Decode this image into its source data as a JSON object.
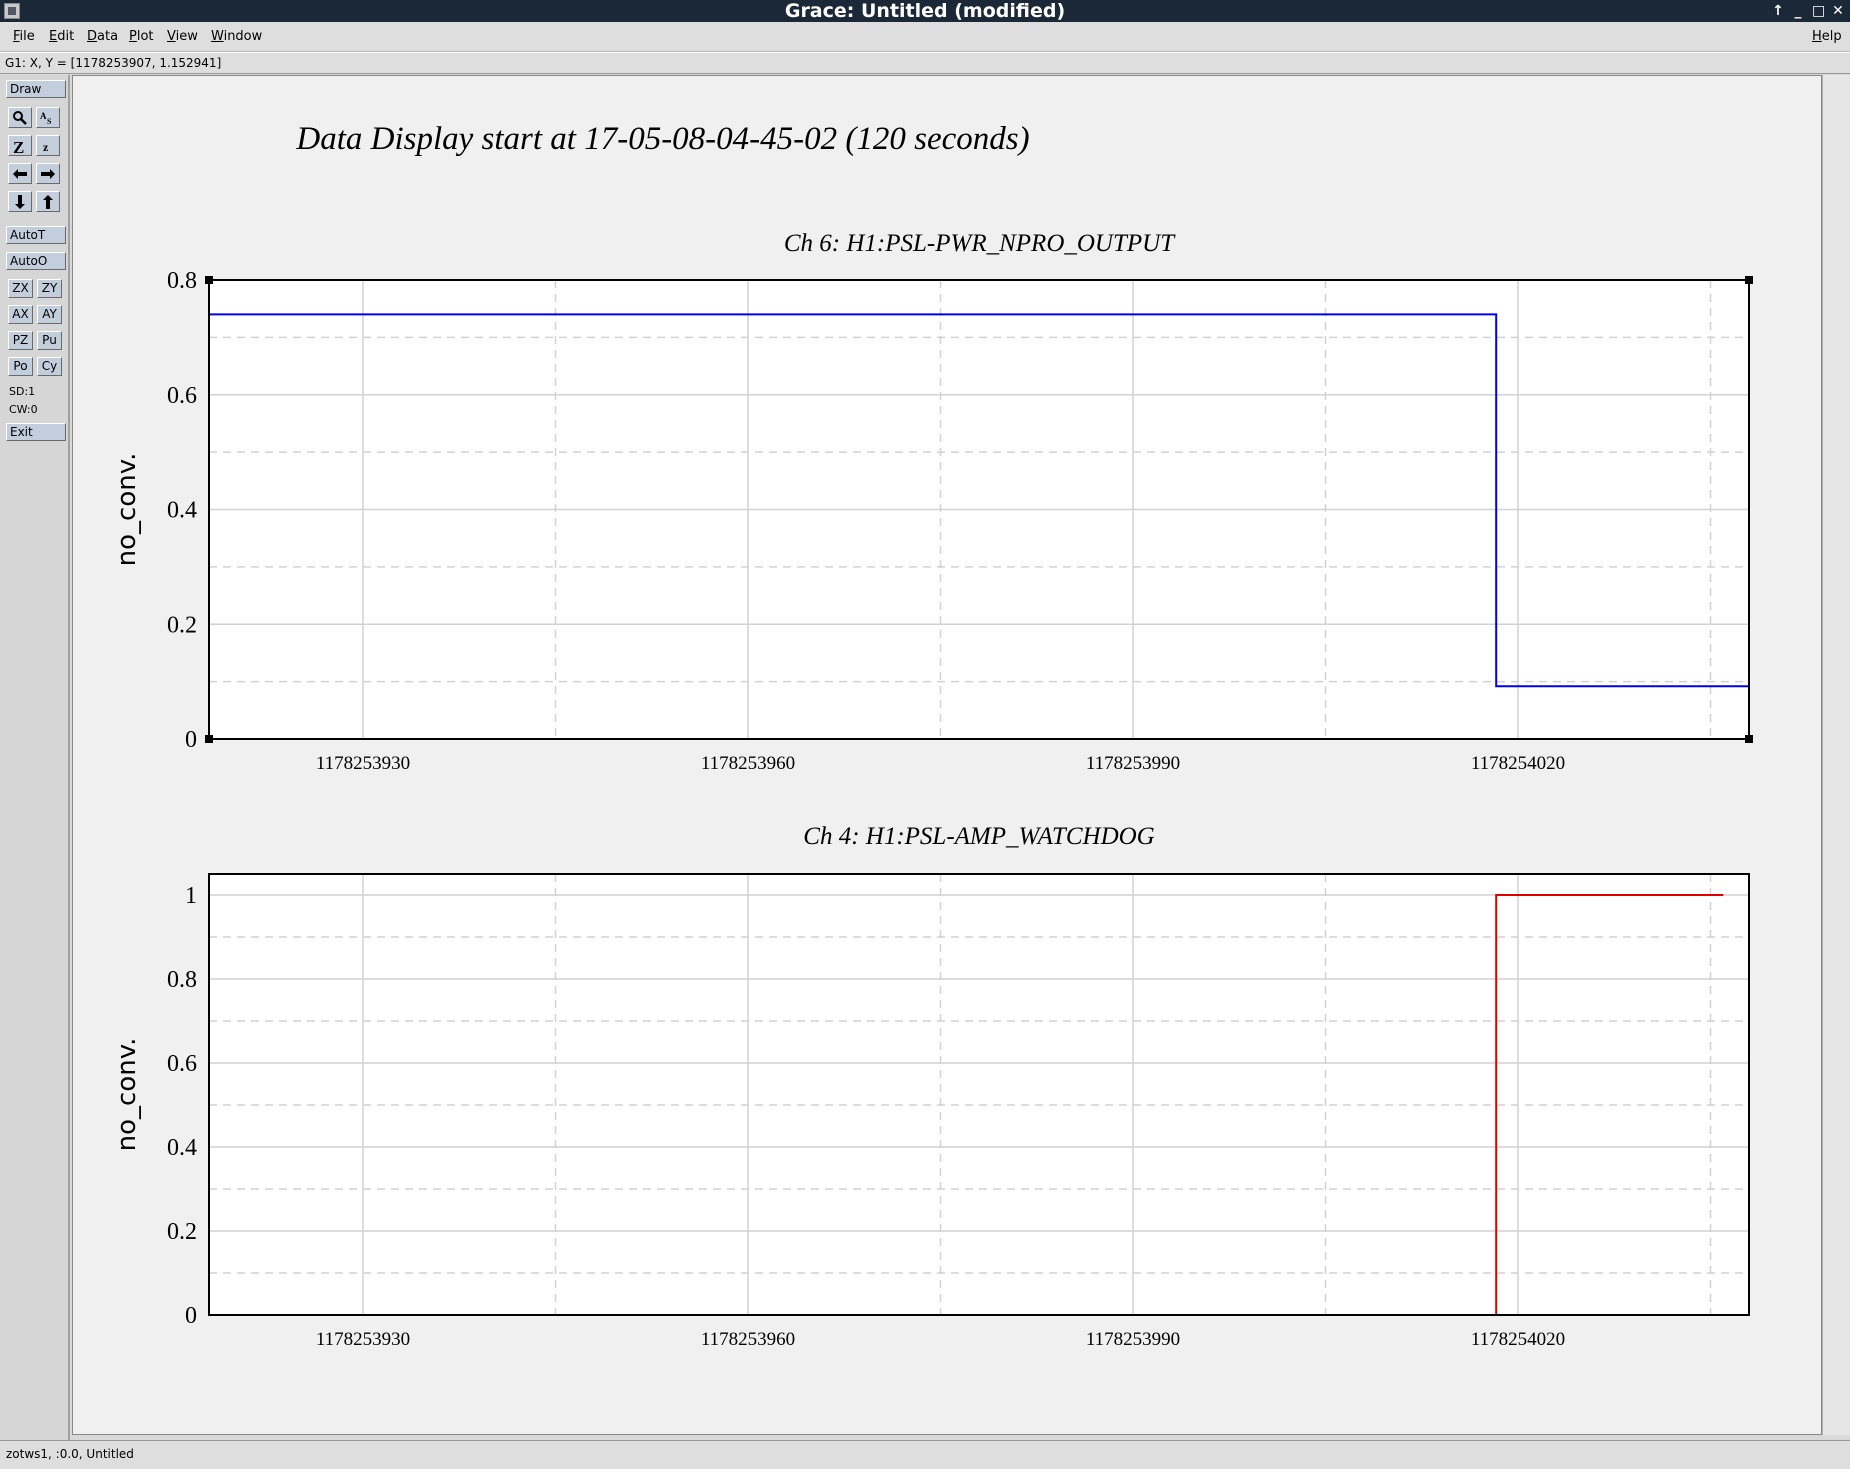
{
  "window": {
    "title": "Grace: Untitled (modified)",
    "controls": [
      "↑",
      "_",
      "□",
      "✕"
    ]
  },
  "menubar": {
    "items": [
      "File",
      "Edit",
      "Data",
      "Plot",
      "View",
      "Window"
    ],
    "help": "Help"
  },
  "status": {
    "locator": "G1: X, Y = [1178253907, 1.152941]",
    "footer": "zotws1, :0.0, Untitled"
  },
  "toolbar": {
    "draw": "Draw",
    "autot": "AutoT",
    "autoo": "AutoO",
    "zx": "ZX",
    "zy": "ZY",
    "ax": "AX",
    "ay": "AY",
    "pz": "PZ",
    "pu": "Pu",
    "po": "Po",
    "cy": "Cy",
    "sd": "SD:1",
    "cw": "CW:0",
    "exit": "Exit",
    "icon_buttons": [
      "zoom-icon",
      "text-icon",
      "zoom-in-icon",
      "zoom-out-icon",
      "arrow-left-icon",
      "arrow-right-icon",
      "arrow-down-icon",
      "arrow-up-icon"
    ]
  },
  "plot": {
    "main_title": "Data Display start at 17-05-08-04-45-02 (120 seconds)"
  },
  "chart_data": [
    {
      "type": "line",
      "title": "Ch 6: H1:PSL-PWR_NPRO_OUTPUT",
      "xlabel": "",
      "ylabel": "no_conv.",
      "xlim": [
        1178253918,
        1178254038
      ],
      "ylim": [
        0,
        0.8
      ],
      "xticks": [
        "1178253930",
        "1178253960",
        "1178253990",
        "1178254020"
      ],
      "yticks": [
        "0",
        "0.2",
        "0.4",
        "0.6",
        "0.8"
      ],
      "grid": true,
      "color": "#0000ee",
      "series": [
        {
          "x": [
            1178253918,
            1178254018.3,
            1178254018.3,
            1178254038
          ],
          "y": [
            0.74,
            0.74,
            0.092,
            0.092
          ]
        }
      ]
    },
    {
      "type": "line",
      "title": "Ch 4: H1:PSL-AMP_WATCHDOG",
      "xlabel": "",
      "ylabel": "no_conv.",
      "xlim": [
        1178253918,
        1178254038
      ],
      "ylim": [
        0,
        1.05
      ],
      "xticks": [
        "1178253930",
        "1178253960",
        "1178253990",
        "1178254020"
      ],
      "yticks": [
        "0",
        "0.2",
        "0.4",
        "0.6",
        "0.8",
        "1"
      ],
      "grid": true,
      "color": "#e00000",
      "series": [
        {
          "x": [
            1178253920,
            1178254018.3,
            1178254018.3,
            1178254036
          ],
          "y": [
            0,
            0,
            1,
            1
          ]
        }
      ]
    }
  ]
}
